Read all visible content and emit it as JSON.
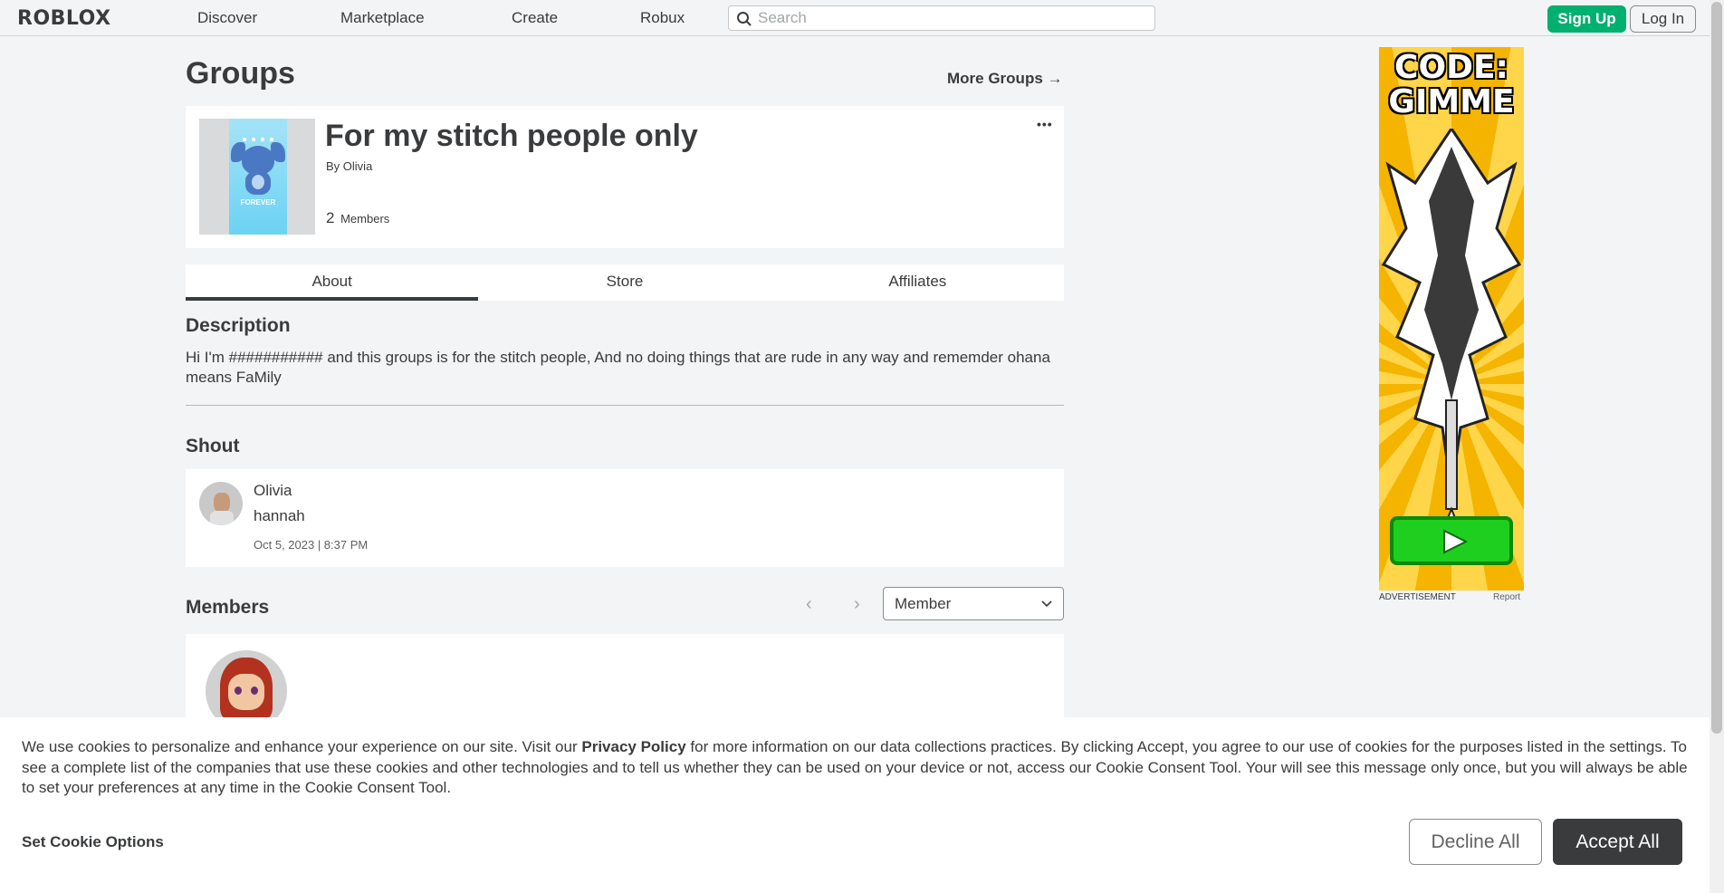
{
  "nav": {
    "logo": "ROBLOX",
    "links": [
      "Discover",
      "Marketplace",
      "Create",
      "Robux"
    ],
    "search_placeholder": "Search",
    "signup": "Sign Up",
    "login": "Log In"
  },
  "page": {
    "title": "Groups",
    "more_groups": "More Groups →"
  },
  "group": {
    "name": "For my stitch people only",
    "by_label": "By",
    "owner": "Olivia",
    "member_count": "2",
    "members_label": "Members",
    "more_icon": "•••",
    "thumb_text": "FOREVER"
  },
  "tabs": [
    "About",
    "Store",
    "Affiliates"
  ],
  "about": {
    "description_title": "Description",
    "description": "Hi I'm ########### and this groups is for the stitch people, And no doing things that are rude in any way and rememder ohana means FaMily"
  },
  "shout": {
    "title": "Shout",
    "user": "Olivia",
    "text": "hannah",
    "date": "Oct 5, 2023 | 8:37 PM"
  },
  "members": {
    "title": "Members",
    "prev_icon": "‹",
    "next_icon": "›",
    "role_selected": "Member"
  },
  "ad": {
    "title": "CODE: GIMME",
    "label": "ADVERTISEMENT",
    "report": "Report"
  },
  "cookie": {
    "text_before": "We use cookies to personalize and enhance your experience on our site. Visit our ",
    "privacy_link": "Privacy Policy",
    "text_after": " for more information on our data collections practices. By clicking Accept, you agree to our use of cookies for the purposes listed in the settings. To see a complete list of the companies that use these cookies and other technologies and to tell us whether they can be used on your device or not, access our Cookie Consent Tool. Your will see this message only once, but you will always be able to set your preferences at any time in the Cookie Consent Tool.",
    "set_options": "Set Cookie Options",
    "decline": "Decline All",
    "accept": "Accept All"
  },
  "colors": {
    "signup_green": "#00b06f",
    "accept_dark": "#393b3d",
    "page_bg": "#f2f4f5"
  }
}
